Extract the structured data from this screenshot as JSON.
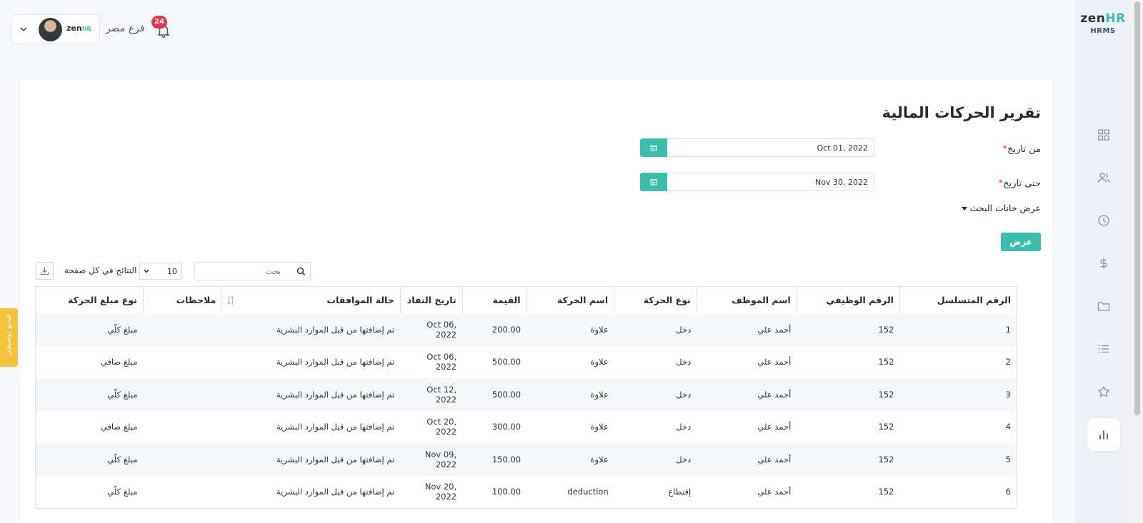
{
  "app": {
    "logo_zen": "zen",
    "logo_hr": "HR",
    "logo_sub": "HRMS"
  },
  "topbar": {
    "branch": "فرع مصر",
    "notifications_count": "24",
    "mini_logo_zen": "zen",
    "mini_logo_hr": "HR"
  },
  "side_tab": "فيديو توضيحي",
  "sidebar": {
    "items": [
      {
        "icon": "dashboard-icon"
      },
      {
        "icon": "users-icon"
      },
      {
        "icon": "clock-icon"
      },
      {
        "icon": "dollar-icon"
      },
      {
        "icon": "folder-icon"
      },
      {
        "icon": "list-icon"
      },
      {
        "icon": "star-icon"
      },
      {
        "icon": "chart-icon",
        "active": true
      }
    ]
  },
  "report": {
    "title": "تقرير الحركات المالية",
    "from_label": "من تاريخ",
    "from_value": "Oct 01, 2022",
    "to_label": "حتى تاريخ",
    "to_value": "Nov 30, 2022",
    "required_mark": "*",
    "toggle_search": "عرض خانات البحث",
    "show_button": "عرض"
  },
  "table_controls": {
    "search_placeholder": "بحث",
    "per_page_value": "10",
    "per_page_label": "النتائج في كل صفحة"
  },
  "table": {
    "headers": [
      "الرقم المتسلسل",
      "الرقم الوظيفي",
      "اسم الموظف",
      "نوع الحركة",
      "اسم الحركة",
      "القيمة",
      "تاريخ النفاذ",
      "حالة الموافقات",
      "ملاحظات",
      "نوع مبلغ الحركة"
    ],
    "rows": [
      [
        "1",
        "152",
        "أحمد علي",
        "دخل",
        "علاوة",
        "200.00",
        "Oct 06, 2022",
        "تم إضافتها من قبل الموارد البشرية",
        "",
        "مبلغ كلّي"
      ],
      [
        "2",
        "152",
        "أحمد علي",
        "دخل",
        "علاوة",
        "500.00",
        "Oct 06, 2022",
        "تم إضافتها من قبل الموارد البشرية",
        "",
        "مبلغ صافي"
      ],
      [
        "3",
        "152",
        "أحمد علي",
        "دخل",
        "علاوة",
        "500.00",
        "Oct 12, 2022",
        "تم إضافتها من قبل الموارد البشرية",
        "",
        "مبلغ كلّي"
      ],
      [
        "4",
        "152",
        "أحمد علي",
        "دخل",
        "علاوة",
        "300.00",
        "Oct 20, 2022",
        "تم إضافتها من قبل الموارد البشرية",
        "",
        "مبلغ صافي"
      ],
      [
        "5",
        "152",
        "أحمد علي",
        "دخل",
        "علاوة",
        "150.00",
        "Nov 09, 2022",
        "تم إضافتها من قبل الموارد البشرية",
        "",
        "مبلغ كلّي"
      ],
      [
        "6",
        "152",
        "أحمد علي",
        "إقتطاع",
        "deduction",
        "100.00",
        "Nov 20, 2022",
        "تم إضافتها من قبل الموارد البشرية",
        "",
        "مبلغ كلّي"
      ]
    ]
  },
  "colors": {
    "accent": "#3bbfad",
    "badge": "#e5354d",
    "side_tab": "#f6c33b"
  }
}
